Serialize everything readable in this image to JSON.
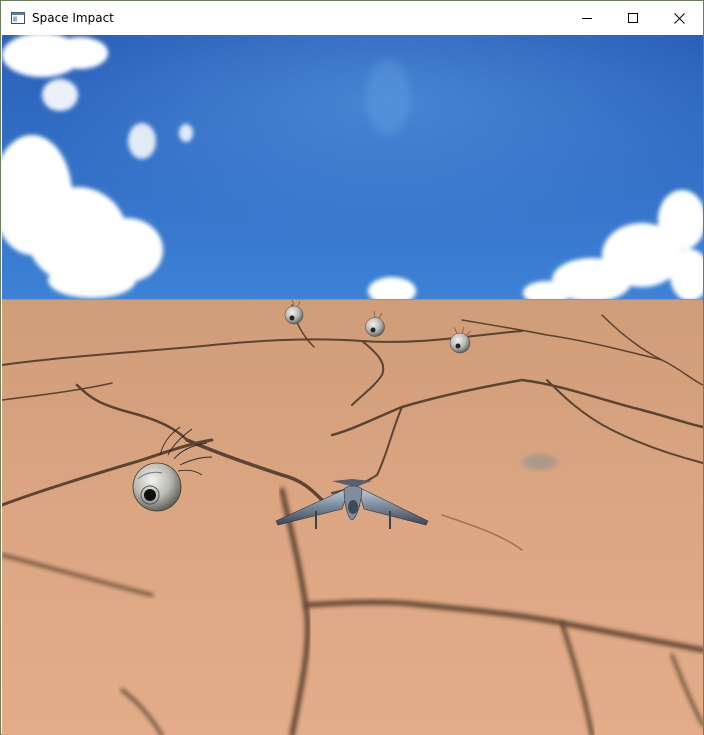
{
  "window": {
    "title": "Space Impact",
    "icon": "app-window-icon",
    "controls": [
      "minimize-icon",
      "maximize-icon",
      "close-icon"
    ]
  },
  "scene": {
    "sky_color": "#2f6cc4",
    "ground_color": "#d9a57d",
    "player": "jet-fighter",
    "enemies": [
      "spiked-mine-large",
      "spiked-mine-small",
      "spiked-mine-small",
      "spiked-mine-small"
    ]
  }
}
